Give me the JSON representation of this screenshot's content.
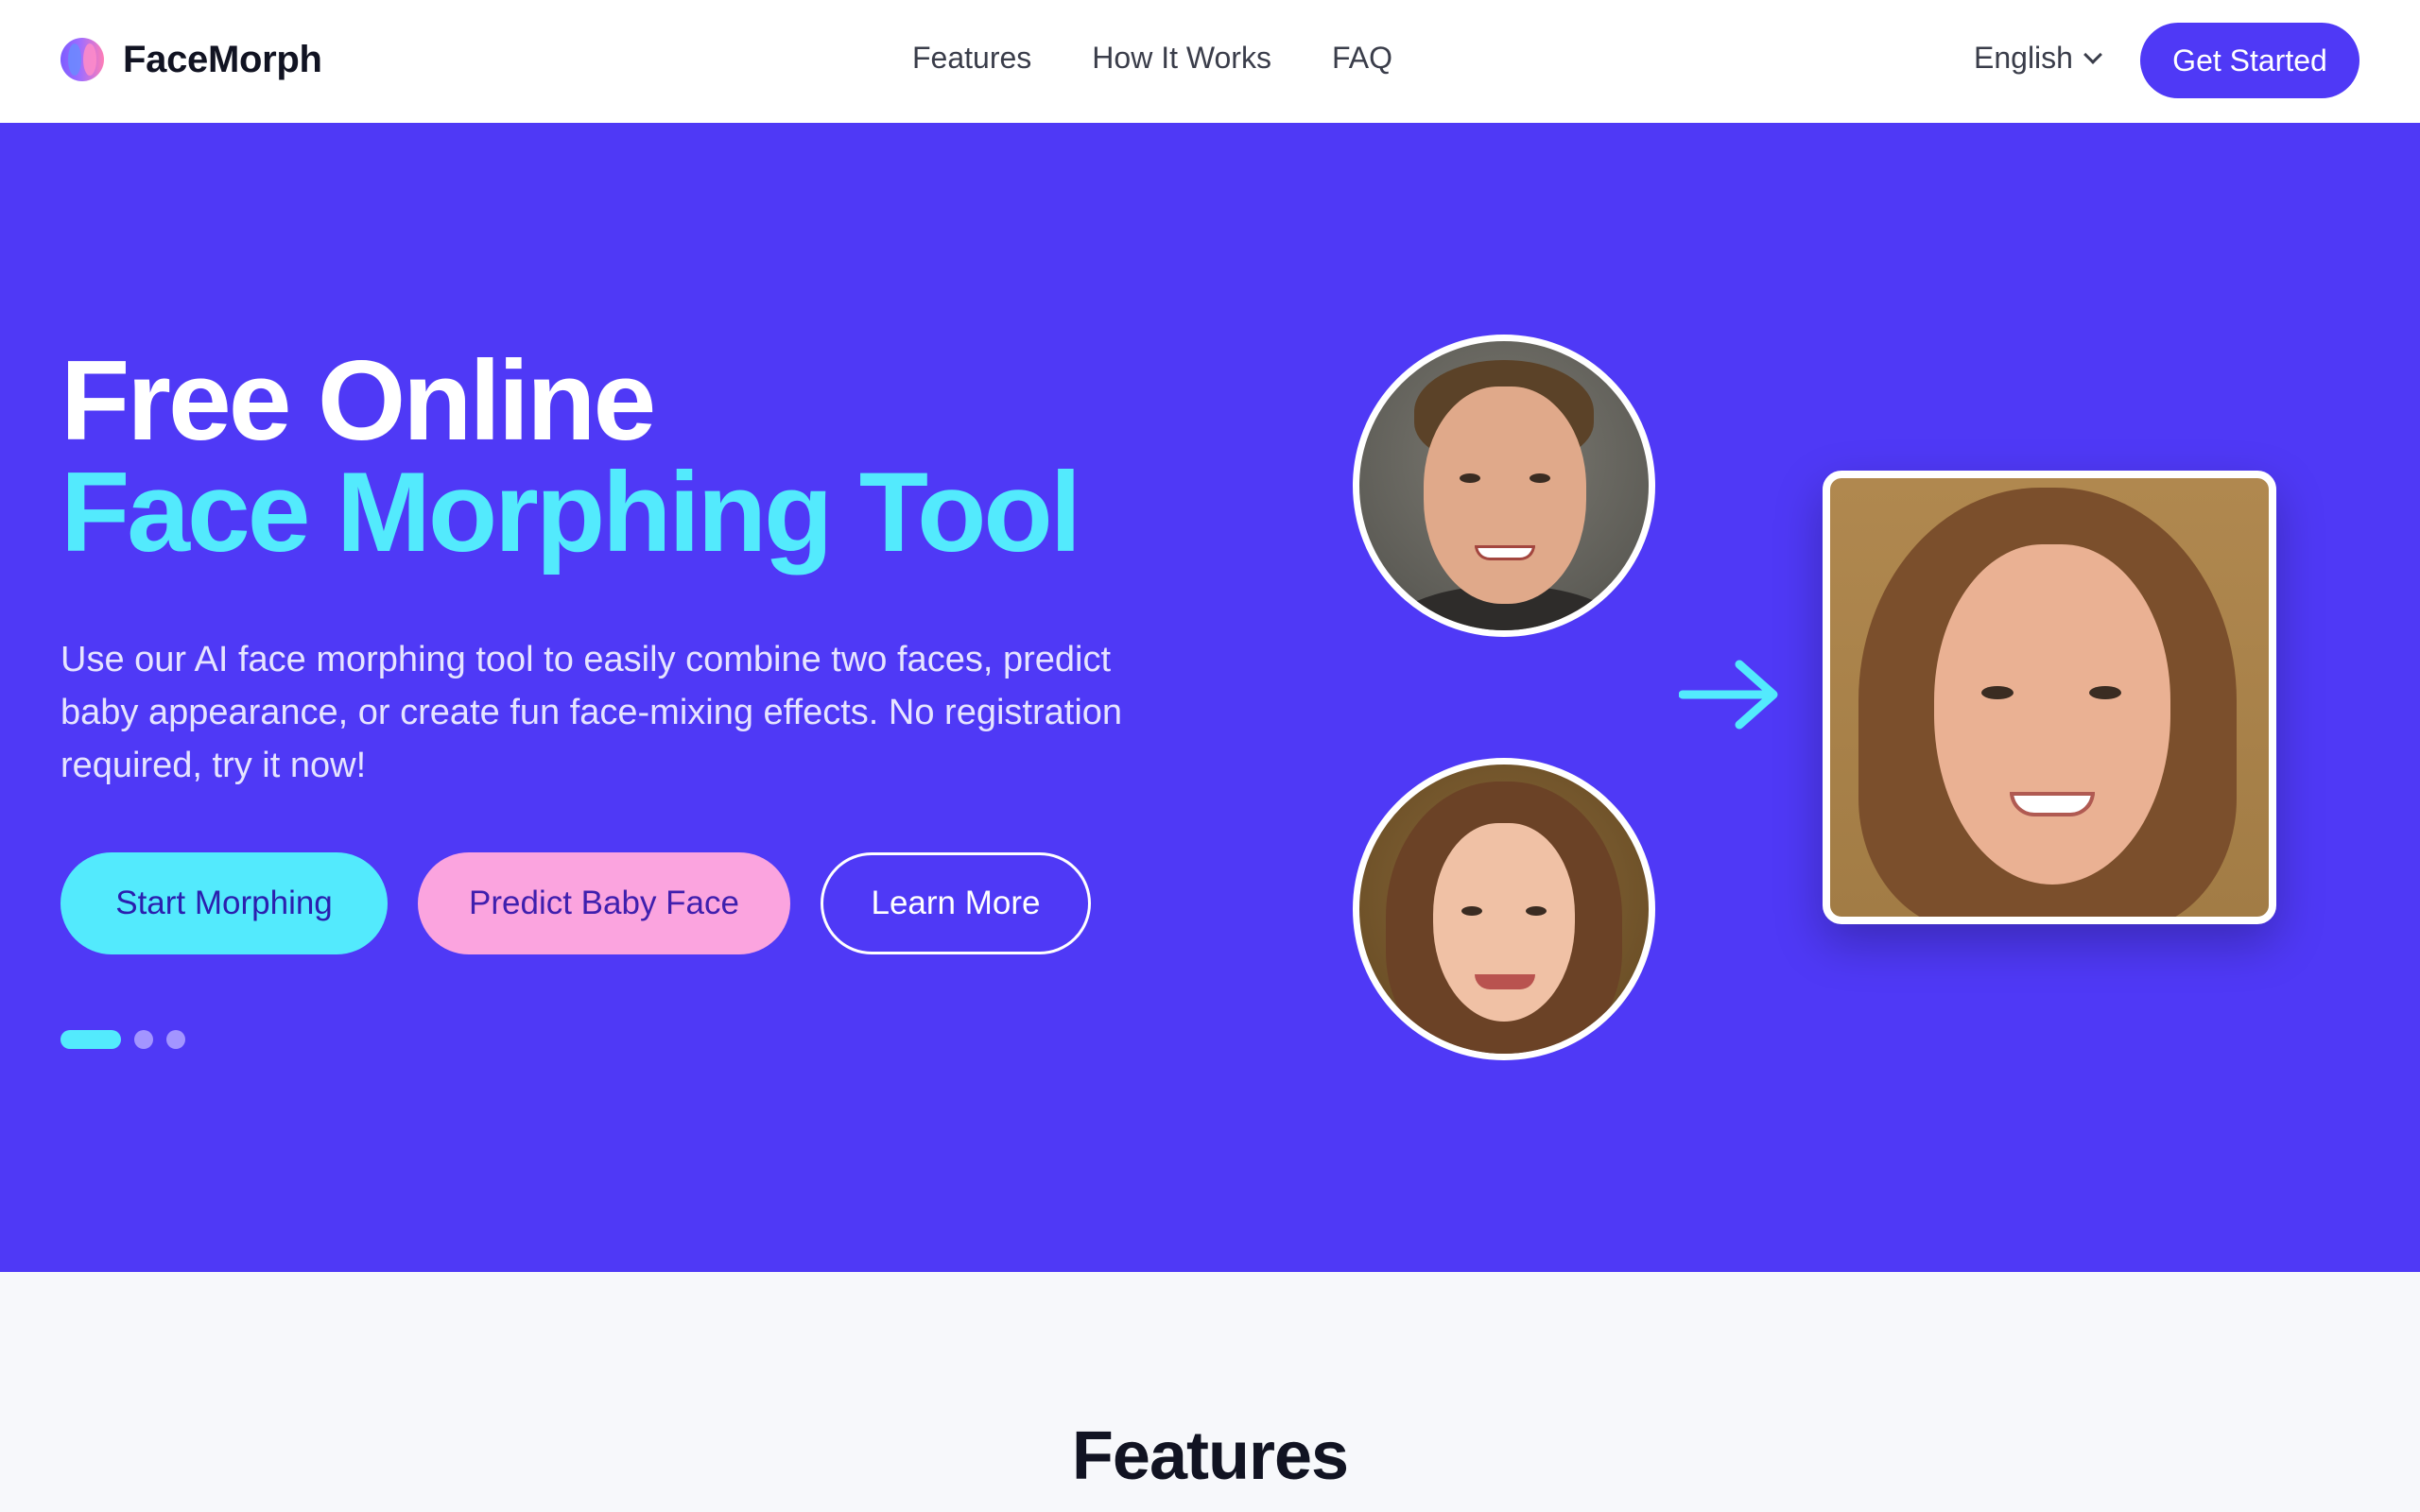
{
  "brand": {
    "name": "FaceMorph"
  },
  "nav": {
    "items": [
      {
        "label": "Features"
      },
      {
        "label": "How It Works"
      },
      {
        "label": "FAQ"
      }
    ],
    "language": "English",
    "cta_label": "Get Started"
  },
  "hero": {
    "title_line1": "Free Online",
    "title_line2": "Face Morphing Tool",
    "description": "Use our AI face morphing tool to easily combine two faces, predict baby appearance, or create fun face-mixing effects. No registration required, try it now!",
    "buttons": {
      "start": "Start Morphing",
      "baby": "Predict Baby Face",
      "learn": "Learn More"
    },
    "carousel": {
      "slides": 3,
      "active": 1
    },
    "plus_symbol": "+"
  },
  "features": {
    "title": "Features"
  },
  "colors": {
    "primary": "#4f39f6",
    "accent_cyan": "#53eafd",
    "accent_pink": "#fba4df",
    "header_bg": "#ffffff",
    "page_bg": "#f7f8fb"
  },
  "icons": {
    "logo": "facemorph-logo-icon",
    "language_chevron": "chevron-down-icon",
    "plus": "plus-icon",
    "arrow": "arrow-right-icon"
  }
}
